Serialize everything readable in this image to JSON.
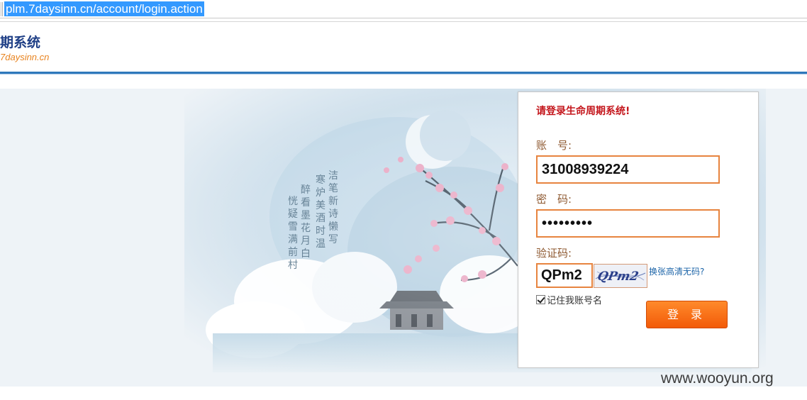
{
  "browser": {
    "url": "plm.7daysinn.cn/account/login.action"
  },
  "header": {
    "title": "期系统",
    "domain": "7daysinn.cn"
  },
  "banner": {
    "poem_columns": [
      "洁笔新诗懒写",
      "寒炉美酒时温",
      "醉看墨花月白",
      "恍疑雪满前村"
    ]
  },
  "login": {
    "heading": "请登录生命周期系统!",
    "account_label": "账　号:",
    "account_value": "31008939224",
    "password_label": "密　码:",
    "password_value": "•••••••••",
    "captcha_label": "验证码:",
    "captcha_value": "QPm2",
    "captcha_image_text": "QPm2",
    "captcha_refresh_link": "换张高清无码?",
    "remember_label": "记住我账号名",
    "submit_label": "登 录"
  },
  "watermark": "www.wooyun.org",
  "colors": {
    "accent_orange": "#e7843f",
    "button_orange": "#f25a08",
    "header_blue": "#2f78bb",
    "heading_red": "#c4161c"
  }
}
